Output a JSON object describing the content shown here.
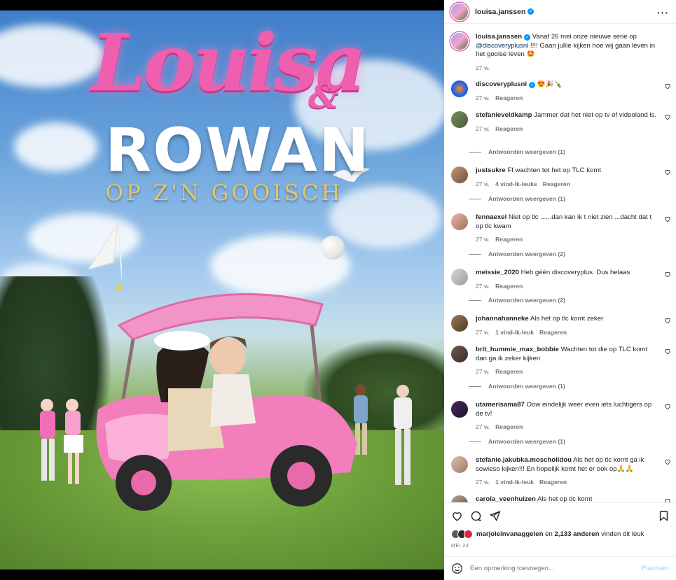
{
  "post": {
    "author": "louisa.janssen",
    "media": {
      "script_title": "Louisa",
      "ampersand": "&",
      "main_title": "ROWAN",
      "subtitle": "OP Z'N GOOISCH"
    },
    "caption": {
      "username": "louisa.janssen",
      "text_before": "Vanaf 26 mei onze nieuwe serie op",
      "mention": "@discoveryplusnl",
      "text_after": "!!!! Gaan jullie kijken hoe wij gaan leven in het gooise leven 🤩",
      "time": "27 w."
    },
    "comments": [
      {
        "username": "discoveryplusnl",
        "verified": true,
        "text": "😍🎉🍾",
        "time": "27 w.",
        "likes": "",
        "reply": "Reageren",
        "replies": ""
      },
      {
        "username": "stefanieveldkamp",
        "verified": false,
        "text": "Jammer dat het niet op tv of videoland is.",
        "time": "27 w.",
        "likes": "",
        "reply": "Reageren",
        "replies": "Antwoorden weergeven (1)"
      },
      {
        "username": "justsukre",
        "verified": false,
        "text": "Ff wachten tot het op TLC komt",
        "time": "27 w.",
        "likes": "4 vind-ik-leuks",
        "reply": "Reageren",
        "replies": "Antwoorden weergeven (1)"
      },
      {
        "username": "fennaexel",
        "verified": false,
        "text": "Niet op tlc ......dan kan ik t niet zien ...dacht dat t op tlc kwam",
        "time": "27 w.",
        "likes": "",
        "reply": "Reageren",
        "replies": "Antwoorden weergeven (2)"
      },
      {
        "username": "meissie_2020",
        "verified": false,
        "text": "Heb géén discoveryplus. Dus helaas",
        "time": "27 w.",
        "likes": "",
        "reply": "Reageren",
        "replies": "Antwoorden weergeven (2)"
      },
      {
        "username": "johannahanneke",
        "verified": false,
        "text": "Als het op tlc komt zeker",
        "time": "27 w.",
        "likes": "1 vind-ik-leuk",
        "reply": "Reageren",
        "replies": ""
      },
      {
        "username": "brit_hummie_max_bobbie",
        "verified": false,
        "text": "Wachten tot die op TLC komt dan ga ik zeker kijken",
        "time": "27 w.",
        "likes": "",
        "reply": "Reageren",
        "replies": "Antwoorden weergeven (1)"
      },
      {
        "username": "utamerisama87",
        "verified": false,
        "text": "Oow eindelijk weer even iets luchtigers op de tv!",
        "time": "27 w.",
        "likes": "",
        "reply": "Reageren",
        "replies": "Antwoorden weergeven (1)"
      },
      {
        "username": "stefanie.jakubka.moscholidou",
        "verified": false,
        "text": "Als het op tlc komt ga ik sowieso kijken!!! En hopelijk komt het er ook op🙏🙏",
        "time": "27 w.",
        "likes": "1 vind-ik-leuk",
        "reply": "Reageren",
        "replies": ""
      },
      {
        "username": "carola_veenhuizen",
        "verified": false,
        "text": "Als het op tlc komt",
        "time": "",
        "likes": "",
        "reply": "",
        "replies": ""
      }
    ],
    "likes": {
      "user": "marjoleinvanaggelen",
      "middle": "en",
      "others": "2,133 anderen",
      "suffix": "vinden dit leuk"
    },
    "date": "MEI 23",
    "compose": {
      "placeholder": "Een opmerking toevoegen...",
      "post_label": "Plaatsen"
    }
  },
  "icons": [
    "more-icon",
    "verified-icon",
    "heart-icon",
    "comment-icon",
    "share-icon",
    "bookmark-icon",
    "emoji-icon"
  ],
  "colors": {
    "link": "#00376b",
    "verified": "#0095f6",
    "secondary_text": "#737373",
    "post_disabled": "#b2dffc",
    "brand_pink": "#ee5fb0"
  }
}
